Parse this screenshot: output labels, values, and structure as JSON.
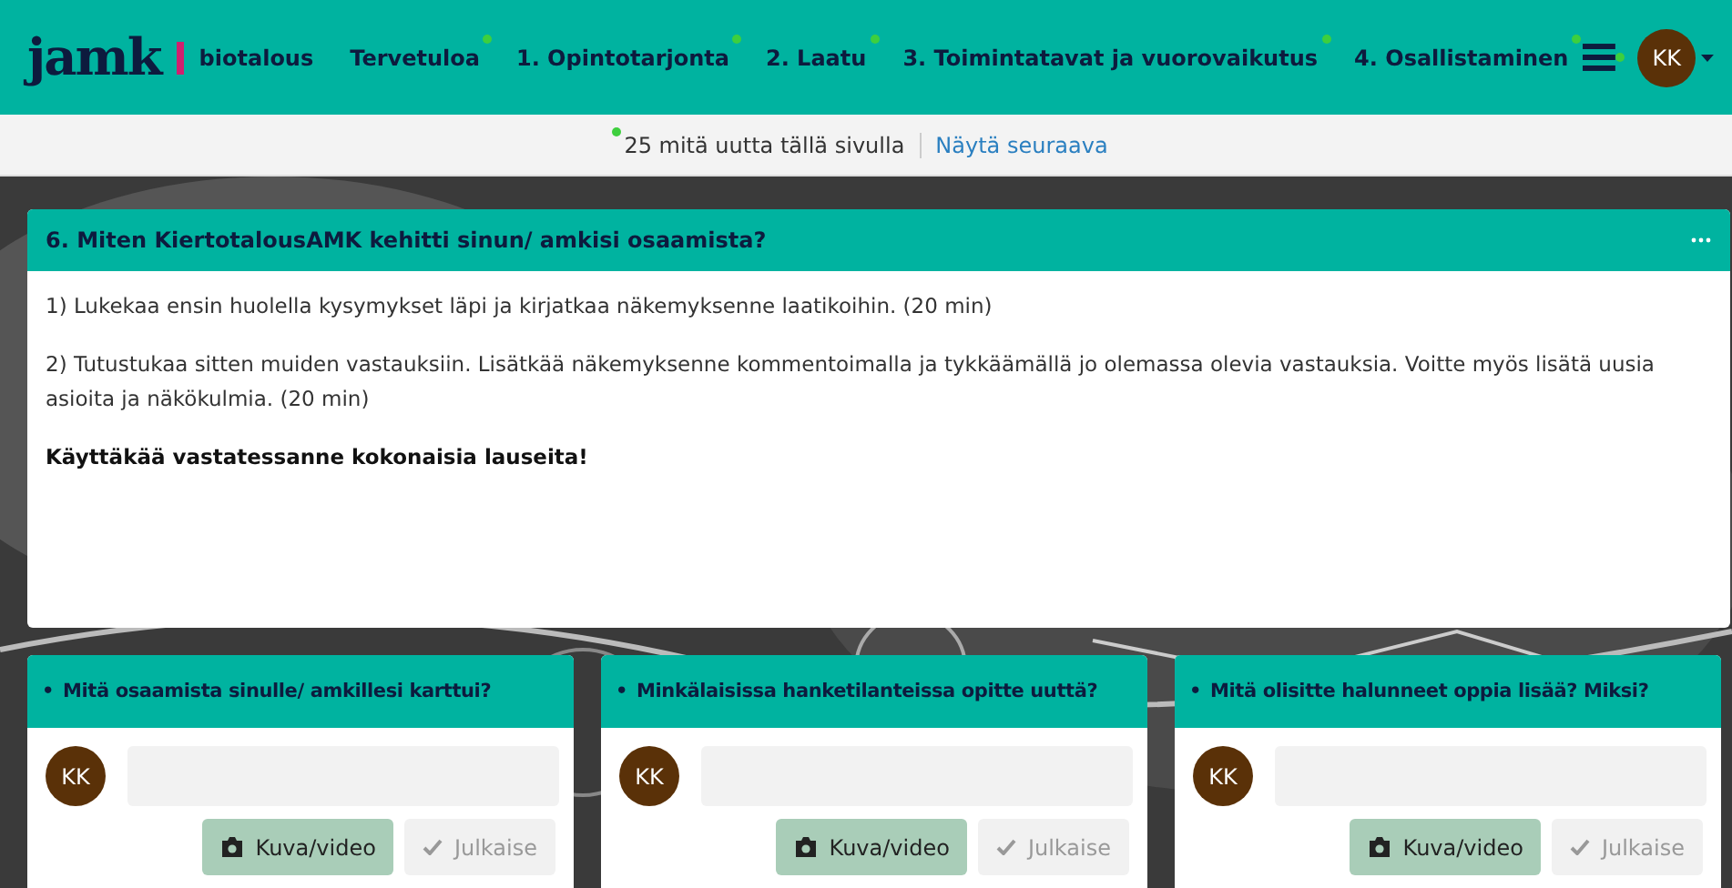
{
  "header": {
    "logo": "jamk",
    "brand": "biotalous",
    "nav": [
      {
        "label": "Tervetuloa",
        "has_new": true
      },
      {
        "label": "1. Opintotarjonta",
        "has_new": true
      },
      {
        "label": "2. Laatu",
        "has_new": true
      },
      {
        "label": "3. Toimintatavat ja vuorovaikutus",
        "has_new": true
      },
      {
        "label": "4. Osallistaminen",
        "has_new": true
      }
    ],
    "menu_has_new": true,
    "avatar": "KK"
  },
  "new_bar": {
    "text": "25 mitä uutta tällä sivulla",
    "link": "Näytä seuraava"
  },
  "prompt": {
    "title": "6. Miten KiertotalousAMK kehitti sinun/ amkisi osaamista?",
    "paragraphs": [
      {
        "text": "1) Lukekaa ensin huolella kysymykset läpi ja kirjatkaa näkemyksenne laatikoihin. (20 min)",
        "bold": false
      },
      {
        "text": "2) Tutustukaa sitten muiden vastauksiin. Lisätkää näkemyksenne kommentoimalla ja tykkäämällä jo olemassa olevia vastauksia. Voitte myös lisätä uusia asioita ja näkökulmia. (20 min)",
        "bold": false
      },
      {
        "text": "Käyttäkää vastatessanne kokonaisia lauseita!",
        "bold": true
      }
    ]
  },
  "columns": [
    {
      "bullet": "•",
      "title": "Mitä osaamista sinulle/ amkillesi karttui?",
      "avatar": "KK",
      "media_button": "Kuva/video",
      "publish_button": "Julkaise"
    },
    {
      "bullet": "•",
      "title": "Minkälaisissa hanketilanteissa opitte uuttä?",
      "avatar": "KK",
      "media_button": "Kuva/video",
      "publish_button": "Julkaise"
    },
    {
      "bullet": "•",
      "title": "Mitä olisitte halunneet oppia lisää? Miksi?",
      "avatar": "KK",
      "media_button": "Kuva/video",
      "publish_button": "Julkaise"
    }
  ]
}
